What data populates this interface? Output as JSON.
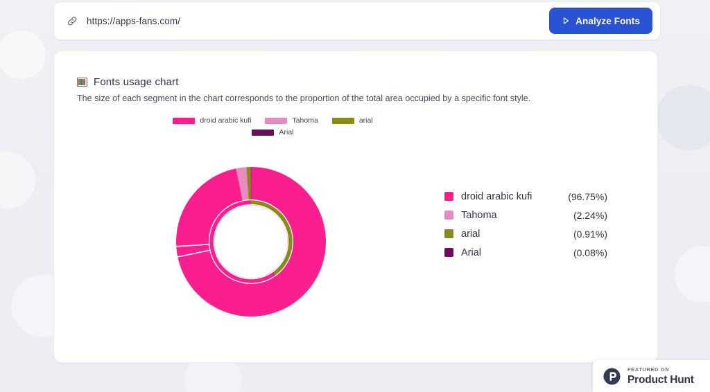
{
  "urlbar": {
    "icon": "link-icon",
    "url": "https://apps-fans.com/",
    "button_label": "Analyze Fonts",
    "button_icon": "play-icon",
    "button_color": "#2a53d3"
  },
  "card": {
    "icon": "chart-bars-icon",
    "title": "Fonts usage chart",
    "description": "The size of each segment in the chart corresponds to the proportion of the total area occupied by a specific font style."
  },
  "chart_data": {
    "type": "pie",
    "title": "Fonts usage chart",
    "subtitle": "The size of each segment in the chart corresponds to the proportion of the total area occupied by a specific font style.",
    "categories": [
      "droid arabic kufi",
      "Tahoma",
      "arial",
      "Arial"
    ],
    "values": [
      96.75,
      2.24,
      0.91,
      0.08
    ],
    "value_labels": [
      "(96.75%)",
      "(2.24%)",
      "(0.91%)",
      "(0.08%)"
    ],
    "colors": [
      "#fb1e8e",
      "#e78cc0",
      "#8a8a1a",
      "#6b0d5e"
    ],
    "unit": "%",
    "legend_position": "top-and-right",
    "grid": false,
    "donut": true,
    "inner_ring": true
  },
  "top_legend": [
    {
      "label": "droid arabic kufi",
      "color": "#fb1e8e"
    },
    {
      "label": "Tahoma",
      "color": "#e78cc0"
    },
    {
      "label": "arial",
      "color": "#8a8a1a"
    },
    {
      "label": "Arial",
      "color": "#6b0d5e"
    }
  ],
  "side_legend": [
    {
      "label": "droid arabic kufi",
      "percent": "(96.75%)",
      "color": "#fb1e8e"
    },
    {
      "label": "Tahoma",
      "percent": "(2.24%)",
      "color": "#e78cc0"
    },
    {
      "label": "arial",
      "percent": "(0.91%)",
      "color": "#8a8a1a"
    },
    {
      "label": "Arial",
      "percent": "(0.08%)",
      "color": "#6b0d5e"
    }
  ],
  "product_hunt": {
    "featured_label": "FEATURED ON",
    "name": "Product Hunt",
    "logo_letter": "P"
  }
}
